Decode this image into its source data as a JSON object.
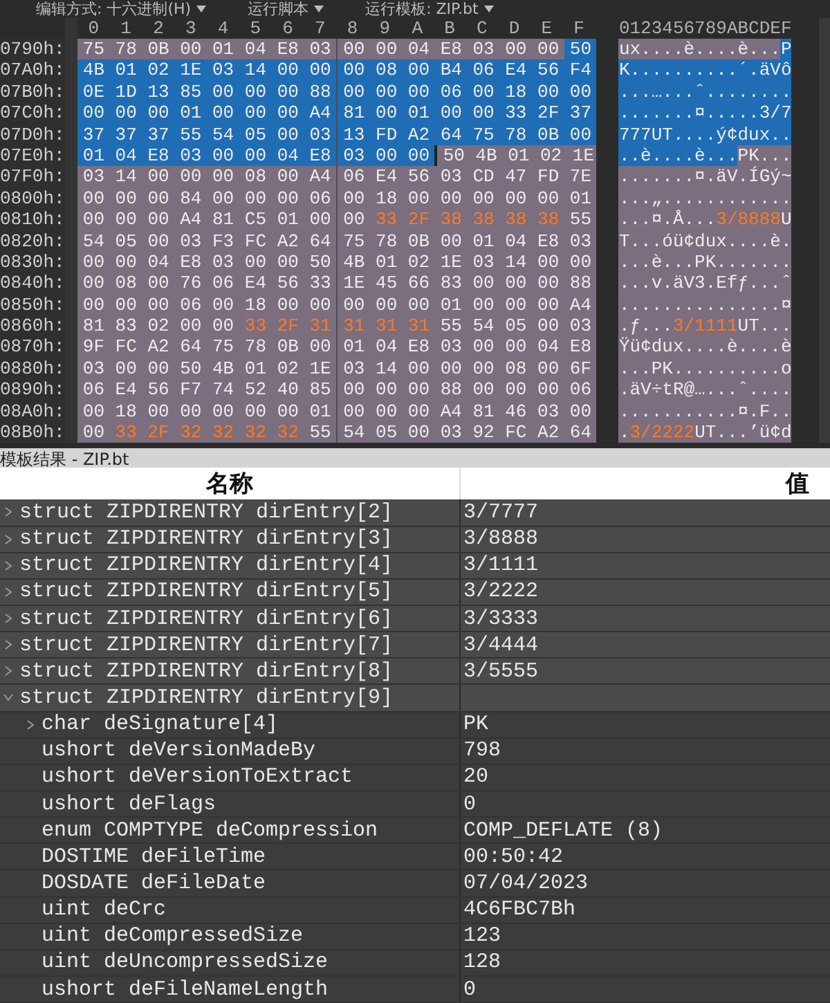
{
  "toolbar": {
    "items": [
      {
        "label": "编辑方式: 十六进制(H)"
      },
      {
        "label": "运行脚本"
      },
      {
        "label": "运行模板: ZIP.bt"
      }
    ]
  },
  "hex_view": {
    "column_header": [
      "0",
      "1",
      "2",
      "3",
      "4",
      "5",
      "6",
      "7",
      "8",
      "9",
      "A",
      "B",
      "C",
      "D",
      "E",
      "F"
    ],
    "ascii_header": "0123456789ABCDEF",
    "rows": [
      {
        "offset": "0790h:",
        "hex_left": [
          {
            "text": "75 78 0B 00 01 04 E8 03",
            "kind": "plain",
            "selected": false
          }
        ],
        "hex_right": [
          {
            "text": "00 00 04 E8 03 00 00",
            "kind": "plain",
            "selected": false
          },
          {
            "text": "50",
            "kind": "plain",
            "selected": true
          }
        ],
        "ascii": [
          {
            "text": "ux....è....è...",
            "kind": "plain",
            "selected": false
          },
          {
            "text": "P",
            "kind": "plain",
            "selected": true
          }
        ]
      },
      {
        "offset": "07A0h:",
        "hex_left": [
          {
            "text": "4B 01 02 1E 03 14 00 00",
            "kind": "plain",
            "selected": true
          }
        ],
        "hex_right": [
          {
            "text": "00 08 00 B4 06 E4 56 F4",
            "kind": "plain",
            "selected": true
          }
        ],
        "ascii": [
          {
            "text": "K..........´.äVô",
            "kind": "plain",
            "selected": true
          }
        ]
      },
      {
        "offset": "07B0h:",
        "hex_left": [
          {
            "text": "0E 1D 13 85 00 00 00 88",
            "kind": "plain",
            "selected": true
          }
        ],
        "hex_right": [
          {
            "text": "00 00 00 06 00 18 00 00",
            "kind": "plain",
            "selected": true
          }
        ],
        "ascii": [
          {
            "text": "...…...ˆ........",
            "kind": "plain",
            "selected": true
          }
        ]
      },
      {
        "offset": "07C0h:",
        "hex_left": [
          {
            "text": "00 00 00 01 00 00 00 A4",
            "kind": "plain",
            "selected": true
          }
        ],
        "hex_right": [
          {
            "text": "81 00 01 00 00 33 2F 37",
            "kind": "plain",
            "selected": true
          }
        ],
        "ascii": [
          {
            "text": ".......¤.....3/7",
            "kind": "plain",
            "selected": true
          }
        ]
      },
      {
        "offset": "07D0h:",
        "hex_left": [
          {
            "text": "37 37 37 55 54 05 00 03",
            "kind": "plain",
            "selected": true
          }
        ],
        "hex_right": [
          {
            "text": "13 FD A2 64 75 78 0B 00",
            "kind": "plain",
            "selected": true
          }
        ],
        "ascii": [
          {
            "text": "777UT....ý¢dux..",
            "kind": "plain",
            "selected": true
          }
        ]
      },
      {
        "offset": "07E0h:",
        "hex_left": [
          {
            "text": "01 04 E8 03 00 00 04 E8",
            "kind": "plain",
            "selected": true
          }
        ],
        "hex_right": [
          {
            "text": "03 00 00",
            "kind": "plain",
            "selected": true
          },
          {
            "text": "50",
            "kind": "cursor",
            "selected": false
          },
          {
            "text": "4B 01 02 1E",
            "kind": "plain",
            "selected": false
          }
        ],
        "ascii": [
          {
            "text": "..è....è...",
            "kind": "plain",
            "selected": true
          },
          {
            "text": "PK...",
            "kind": "plain",
            "selected": false
          }
        ]
      },
      {
        "offset": "07F0h:",
        "hex_left": [
          {
            "text": "03 14 00 00 00 08 00 A4",
            "kind": "plain",
            "selected": false
          }
        ],
        "hex_right": [
          {
            "text": "06 E4 56 03 CD 47 FD 7E",
            "kind": "plain",
            "selected": false
          }
        ],
        "ascii": [
          {
            "text": ".......¤.äV.ÍGý~",
            "kind": "plain",
            "selected": false
          }
        ]
      },
      {
        "offset": "0800h:",
        "hex_left": [
          {
            "text": "00 00 00 84 00 00 00 06",
            "kind": "plain",
            "selected": false
          }
        ],
        "hex_right": [
          {
            "text": "00 18 00 00 00 00 00 01",
            "kind": "plain",
            "selected": false
          }
        ],
        "ascii": [
          {
            "text": "...„............",
            "kind": "plain",
            "selected": false
          }
        ]
      },
      {
        "offset": "0810h:",
        "hex_left": [
          {
            "text": "00 00 00 A4 81 C5 01 00",
            "kind": "plain",
            "selected": false
          }
        ],
        "hex_right": [
          {
            "text": "00",
            "kind": "plain",
            "selected": false
          },
          {
            "text": "33 2F 38 38 38 38",
            "kind": "string",
            "selected": false
          },
          {
            "text": "55",
            "kind": "plain",
            "selected": false
          }
        ],
        "ascii": [
          {
            "text": "...¤.Å...",
            "kind": "plain",
            "selected": false
          },
          {
            "text": "3/8888",
            "kind": "string",
            "selected": false
          },
          {
            "text": "U",
            "kind": "plain",
            "selected": false
          }
        ]
      },
      {
        "offset": "0820h:",
        "hex_left": [
          {
            "text": "54 05 00 03 F3 FC A2 64",
            "kind": "plain",
            "selected": false
          }
        ],
        "hex_right": [
          {
            "text": "75 78 0B 00 01 04 E8 03",
            "kind": "plain",
            "selected": false
          }
        ],
        "ascii": [
          {
            "text": "T...óü¢dux....è.",
            "kind": "plain",
            "selected": false
          }
        ]
      },
      {
        "offset": "0830h:",
        "hex_left": [
          {
            "text": "00 00 04 E8 03 00 00 50",
            "kind": "plain",
            "selected": false
          }
        ],
        "hex_right": [
          {
            "text": "4B 01 02 1E 03 14 00 00",
            "kind": "plain",
            "selected": false
          }
        ],
        "ascii": [
          {
            "text": "...è...PK.......",
            "kind": "plain",
            "selected": false
          }
        ]
      },
      {
        "offset": "0840h:",
        "hex_left": [
          {
            "text": "00 08 00 76 06 E4 56 33",
            "kind": "plain",
            "selected": false
          }
        ],
        "hex_right": [
          {
            "text": "1E 45 66 83 00 00 00 88",
            "kind": "plain",
            "selected": false
          }
        ],
        "ascii": [
          {
            "text": "...v.äV3.Efƒ...ˆ",
            "kind": "plain",
            "selected": false
          }
        ]
      },
      {
        "offset": "0850h:",
        "hex_left": [
          {
            "text": "00 00 00 06 00 18 00 00",
            "kind": "plain",
            "selected": false
          }
        ],
        "hex_right": [
          {
            "text": "00 00 00 01 00 00 00 A4",
            "kind": "plain",
            "selected": false
          }
        ],
        "ascii": [
          {
            "text": "...............¤",
            "kind": "plain",
            "selected": false
          }
        ]
      },
      {
        "offset": "0860h:",
        "hex_left": [
          {
            "text": "81 83 02 00 00",
            "kind": "plain",
            "selected": false
          },
          {
            "text": "33 2F 31",
            "kind": "string",
            "selected": false
          }
        ],
        "hex_right": [
          {
            "text": "31 31 31",
            "kind": "string",
            "selected": false
          },
          {
            "text": "55 54 05 00 03",
            "kind": "plain",
            "selected": false
          }
        ],
        "ascii": [
          {
            "text": ".ƒ...",
            "kind": "plain",
            "selected": false
          },
          {
            "text": "3/1111",
            "kind": "string",
            "selected": false
          },
          {
            "text": "UT...",
            "kind": "plain",
            "selected": false
          }
        ]
      },
      {
        "offset": "0870h:",
        "hex_left": [
          {
            "text": "9F FC A2 64 75 78 0B 00",
            "kind": "plain",
            "selected": false
          }
        ],
        "hex_right": [
          {
            "text": "01 04 E8 03 00 00 04 E8",
            "kind": "plain",
            "selected": false
          }
        ],
        "ascii": [
          {
            "text": "Ÿü¢dux....è....è",
            "kind": "plain",
            "selected": false
          }
        ]
      },
      {
        "offset": "0880h:",
        "hex_left": [
          {
            "text": "03 00 00 50 4B 01 02 1E",
            "kind": "plain",
            "selected": false
          }
        ],
        "hex_right": [
          {
            "text": "03 14 00 00 00 08 00 6F",
            "kind": "plain",
            "selected": false
          }
        ],
        "ascii": [
          {
            "text": "...PK..........o",
            "kind": "plain",
            "selected": false
          }
        ]
      },
      {
        "offset": "0890h:",
        "hex_left": [
          {
            "text": "06 E4 56 F7 74 52 40 85",
            "kind": "plain",
            "selected": false
          }
        ],
        "hex_right": [
          {
            "text": "00 00 00 88 00 00 00 06",
            "kind": "plain",
            "selected": false
          }
        ],
        "ascii": [
          {
            "text": ".äV÷tR@…...ˆ....",
            "kind": "plain",
            "selected": false
          }
        ]
      },
      {
        "offset": "08A0h:",
        "hex_left": [
          {
            "text": "00 18 00 00 00 00 00 01",
            "kind": "plain",
            "selected": false
          }
        ],
        "hex_right": [
          {
            "text": "00 00 00 A4 81 46 03 00",
            "kind": "plain",
            "selected": false
          }
        ],
        "ascii": [
          {
            "text": "...........¤.F..",
            "kind": "plain",
            "selected": false
          }
        ]
      },
      {
        "offset": "08B0h:",
        "hex_left": [
          {
            "text": "00",
            "kind": "plain",
            "selected": false
          },
          {
            "text": "33 2F 32 32 32 32",
            "kind": "string",
            "selected": false
          },
          {
            "text": "55",
            "kind": "plain",
            "selected": false
          }
        ],
        "hex_right": [
          {
            "text": "54 05 00 03 92 FC A2 64",
            "kind": "plain",
            "selected": false
          }
        ],
        "ascii": [
          {
            "text": ".",
            "kind": "plain",
            "selected": false
          },
          {
            "text": "3/2222",
            "kind": "string",
            "selected": false
          },
          {
            "text": "UT...’ü¢d",
            "kind": "plain",
            "selected": false
          }
        ]
      }
    ]
  },
  "template_results": {
    "title": "模板结果 - ZIP.bt",
    "columns": [
      "名称",
      "值"
    ],
    "rows": [
      {
        "name": "struct ZIPDIRENTRY dirEntry[2]",
        "value": "3/7777",
        "expanded": false
      },
      {
        "name": "struct ZIPDIRENTRY dirEntry[3]",
        "value": "3/8888",
        "expanded": false
      },
      {
        "name": "struct ZIPDIRENTRY dirEntry[4]",
        "value": "3/1111",
        "expanded": false
      },
      {
        "name": "struct ZIPDIRENTRY dirEntry[5]",
        "value": "3/2222",
        "expanded": false
      },
      {
        "name": "struct ZIPDIRENTRY dirEntry[6]",
        "value": "3/3333",
        "expanded": false
      },
      {
        "name": "struct ZIPDIRENTRY dirEntry[7]",
        "value": "3/4444",
        "expanded": false
      },
      {
        "name": "struct ZIPDIRENTRY dirEntry[8]",
        "value": "3/5555",
        "expanded": false
      },
      {
        "name": "struct ZIPDIRENTRY dirEntry[9]",
        "expanded": true,
        "children": [
          {
            "name": "char deSignature[4]",
            "value": "PK",
            "expanded": false
          },
          {
            "name": "ushort deVersionMadeBy",
            "value": "798"
          },
          {
            "name": "ushort deVersionToExtract",
            "value": "20"
          },
          {
            "name": "ushort deFlags",
            "value": "0"
          },
          {
            "name": "enum COMPTYPE deCompression",
            "value": "COMP_DEFLATE (8)"
          },
          {
            "name": "DOSTIME deFileTime",
            "value": "00:50:42"
          },
          {
            "name": "DOSDATE deFileDate",
            "value": "07/04/2023"
          },
          {
            "name": "uint deCrc",
            "value": "4C6FBC7Bh"
          },
          {
            "name": "uint deCompressedSize",
            "value": "123"
          },
          {
            "name": "uint deUncompressedSize",
            "value": "128"
          },
          {
            "name": "ushort deFileNameLength",
            "value": "0"
          }
        ]
      }
    ]
  }
}
